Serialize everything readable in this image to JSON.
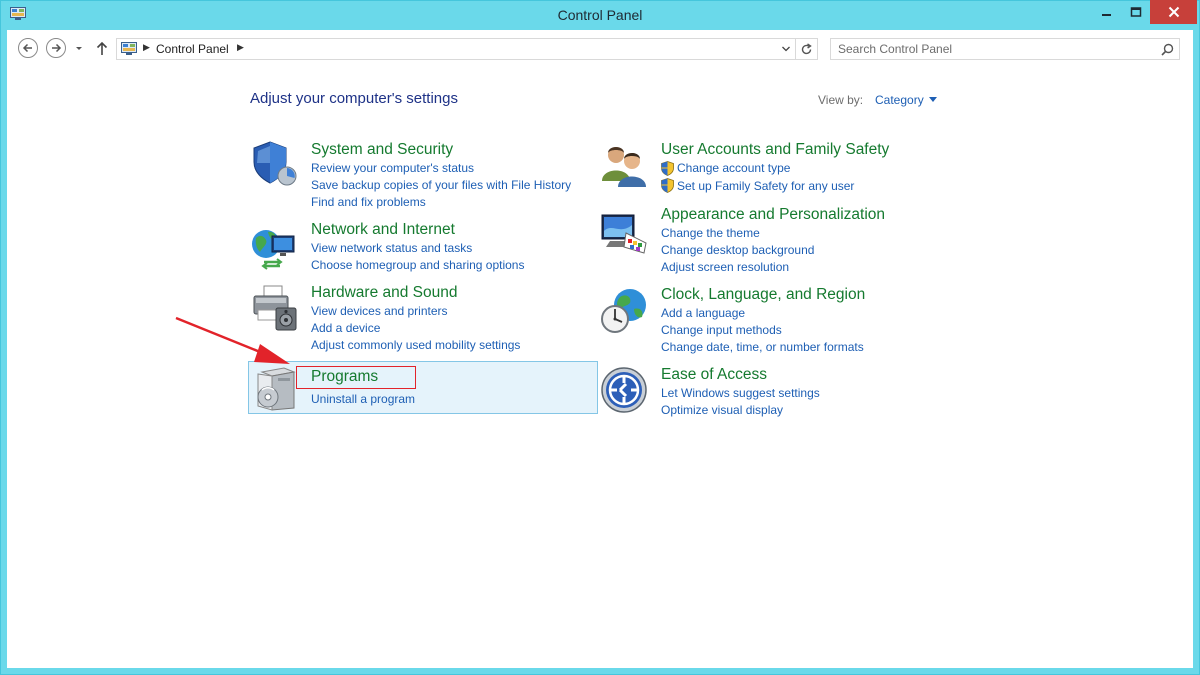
{
  "window": {
    "title": "Control Panel"
  },
  "nav": {
    "breadcrumb": [
      "Control Panel"
    ],
    "search_placeholder": "Search Control Panel"
  },
  "header": {
    "title": "Adjust your computer's settings",
    "view_by_label": "View by:",
    "view_by_value": "Category"
  },
  "categories": [
    {
      "title": "System and Security",
      "icon": "shield-icon",
      "links": [
        "Review your computer's status",
        "Save backup copies of your files with File History",
        "Find and fix problems"
      ]
    },
    {
      "title": "Network and Internet",
      "icon": "network-globe-icon",
      "links": [
        "View network status and tasks",
        "Choose homegroup and sharing options"
      ]
    },
    {
      "title": "Hardware and Sound",
      "icon": "printer-speaker-icon",
      "links": [
        "View devices and printers",
        "Add a device",
        "Adjust commonly used mobility settings"
      ]
    },
    {
      "title": "Programs",
      "icon": "programs-icon",
      "links": [
        "Uninstall a program"
      ]
    },
    {
      "title": "User Accounts and Family Safety",
      "icon": "users-icon",
      "links": [
        "Change account type",
        "Set up Family Safety for any user"
      ]
    },
    {
      "title": "Appearance and Personalization",
      "icon": "monitor-palette-icon",
      "links": [
        "Change the theme",
        "Change desktop background",
        "Adjust screen resolution"
      ]
    },
    {
      "title": "Clock, Language, and Region",
      "icon": "clock-globe-icon",
      "links": [
        "Add a language",
        "Change input methods",
        "Change date, time, or number formats"
      ]
    },
    {
      "title": "Ease of Access",
      "icon": "ease-of-access-icon",
      "links": [
        "Let Windows suggest settings",
        "Optimize visual display"
      ]
    }
  ],
  "colors": {
    "window_frame": "#6ad9ea",
    "category_title": "#157a2f",
    "link": "#1e5fb4",
    "highlight_bg": "#e5f3fb",
    "annotation_red": "#e2232a"
  }
}
